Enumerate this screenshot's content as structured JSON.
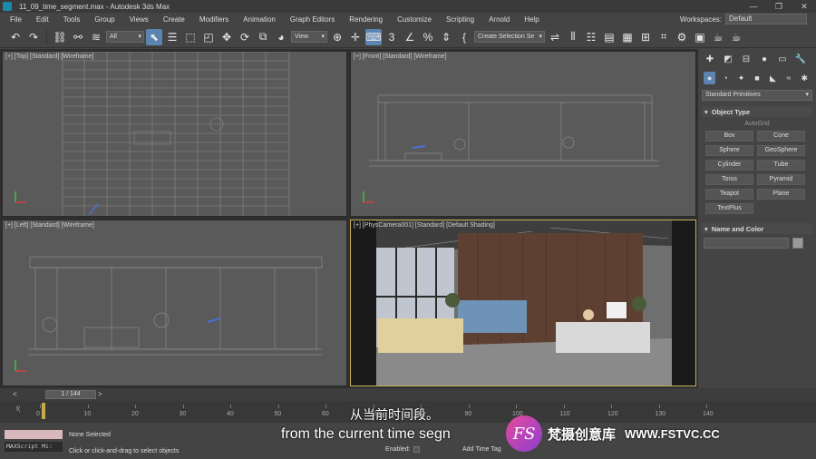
{
  "window": {
    "title": "11_09_time_segment.max - Autodesk 3ds Max",
    "controls": [
      "—",
      "❐",
      "✕"
    ]
  },
  "menubar": {
    "items": [
      "File",
      "Edit",
      "Tools",
      "Group",
      "Views",
      "Create",
      "Modifiers",
      "Animation",
      "Graph Editors",
      "Rendering",
      "Customize",
      "Scripting",
      "Arnold",
      "Help"
    ],
    "workspaces_label": "Workspaces:",
    "workspaces_value": "Default"
  },
  "toolbar": {
    "filter_value": "All",
    "refcoord_value": "View",
    "selection_set_placeholder": "Create Selection Se"
  },
  "viewports": {
    "top": "[+] [Top] [Standard] [Wireframe]",
    "front": "[+] [Front] [Standard] [Wireframe]",
    "left": "[+] [Left] [Standard] [Wireframe]",
    "camera": "[+] [PhysCamera001] [Standard] [Default Shading]"
  },
  "command_panel": {
    "dropdown_value": "Standard Primitives",
    "object_type_title": "Object Type",
    "autogrid_label": "AutoGrid",
    "buttons": [
      "Box",
      "Cone",
      "Sphere",
      "GeoSphere",
      "Cylinder",
      "Tube",
      "Torus",
      "Pyramid",
      "Teapot",
      "Plane",
      "TextPlus"
    ],
    "name_color_title": "Name and Color",
    "swatch_color": "#9a9a9a"
  },
  "timeline": {
    "frame_display": "1 / 144",
    "ticks": [
      "0",
      "10",
      "20",
      "30",
      "40",
      "50",
      "60",
      "70",
      "80",
      "90",
      "100",
      "110",
      "120",
      "130",
      "140"
    ],
    "current_frame": 1,
    "total_frames": 144
  },
  "statusbar": {
    "maxscript_label": "MAXScript Mi:",
    "selection_status": "None Selected",
    "prompt": "Click or click-and-drag to select objects",
    "enabled_label": "Enabled:",
    "add_time_tag": "Add Time Tag"
  },
  "overlay": {
    "subtitle_cn": "从当前时间段。",
    "subtitle_en": "from the current time segn",
    "watermark_logo": "FS",
    "watermark_cn": "梵摄创意库",
    "watermark_url": "WWW.FSTVC.CC"
  },
  "colors": {
    "active_tool": "#5b84b0",
    "active_viewport_border": "#c9b15a",
    "viewport_bg": "#5a5a5a"
  }
}
